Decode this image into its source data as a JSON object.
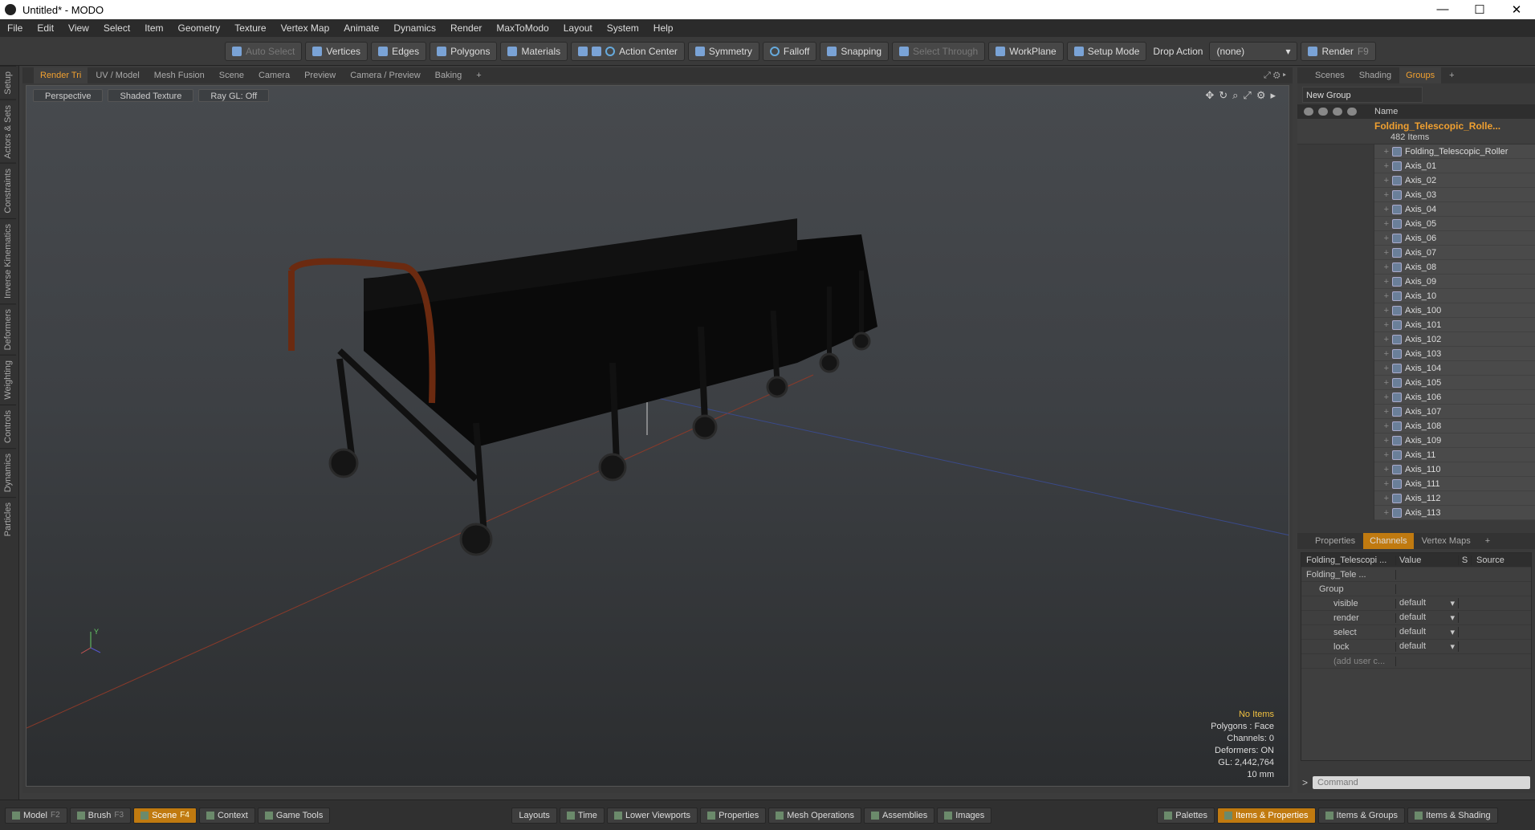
{
  "window": {
    "title": "Untitled* - MODO",
    "controls": [
      "—",
      "☐",
      "✕"
    ]
  },
  "menu": [
    "File",
    "Edit",
    "View",
    "Select",
    "Item",
    "Geometry",
    "Texture",
    "Vertex Map",
    "Animate",
    "Dynamics",
    "Render",
    "MaxToModo",
    "Layout",
    "System",
    "Help"
  ],
  "toolbar": {
    "auto_select": "Auto Select",
    "vertices": "Vertices",
    "edges": "Edges",
    "polygons": "Polygons",
    "materials": "Materials",
    "action_center": "Action Center",
    "symmetry": "Symmetry",
    "falloff": "Falloff",
    "snapping": "Snapping",
    "select_through": "Select Through",
    "workplane": "WorkPlane",
    "setup_mode": "Setup Mode",
    "drop_action_label": "Drop Action",
    "drop_action_value": "(none)",
    "render": "Render",
    "render_key": "F9"
  },
  "left_tabs": [
    "Setup",
    "Actors & Sets",
    "Constraints",
    "Inverse Kinematics",
    "Deformers",
    "Weighting",
    "Controls",
    "Dynamics",
    "Particles"
  ],
  "viewport_tabs": [
    "Render Tri",
    "UV / Model",
    "Mesh Fusion",
    "Scene",
    "Camera",
    "Preview",
    "Camera / Preview",
    "Baking",
    "+"
  ],
  "viewport": {
    "view": "Perspective",
    "shading": "Shaded Texture",
    "raygl": "Ray GL: Off",
    "stats": {
      "items": "No Items",
      "polygons": "Polygons : Face",
      "channels": "Channels: 0",
      "deformers": "Deformers: ON",
      "gl": "GL: 2,442,764",
      "scale": "10 mm"
    },
    "axis_y": "Y"
  },
  "right_tabs": [
    "Scenes",
    "Shading",
    "Groups",
    "+"
  ],
  "groups": {
    "new_group": "New Group",
    "name_header": "Name",
    "group_name": "Folding_Telescopic_Rolle...",
    "group_count": "482 Items",
    "items": [
      "Folding_Telescopic_Roller",
      "Axis_01",
      "Axis_02",
      "Axis_03",
      "Axis_04",
      "Axis_05",
      "Axis_06",
      "Axis_07",
      "Axis_08",
      "Axis_09",
      "Axis_10",
      "Axis_100",
      "Axis_101",
      "Axis_102",
      "Axis_103",
      "Axis_104",
      "Axis_105",
      "Axis_106",
      "Axis_107",
      "Axis_108",
      "Axis_109",
      "Axis_11",
      "Axis_110",
      "Axis_111",
      "Axis_112",
      "Axis_113"
    ]
  },
  "props_tabs": [
    "Properties",
    "Channels",
    "Vertex Maps",
    "+"
  ],
  "channels": {
    "header": [
      "Folding_Telescopi ...",
      "Value",
      "S",
      "Source"
    ],
    "root": "Folding_Tele ...",
    "group": "Group",
    "rows": [
      {
        "name": "visible",
        "value": "default"
      },
      {
        "name": "render",
        "value": "default"
      },
      {
        "name": "select",
        "value": "default"
      },
      {
        "name": "lock",
        "value": "default"
      }
    ],
    "add_user": "(add user c..."
  },
  "command": {
    "prompt": ">",
    "placeholder": "Command"
  },
  "bottom": {
    "model": "Model",
    "model_key": "F2",
    "brush": "Brush",
    "brush_key": "F3",
    "scene": "Scene",
    "scene_key": "F4",
    "context": "Context",
    "game_tools": "Game Tools",
    "layouts": "Layouts",
    "time": "Time",
    "lower_viewports": "Lower Viewports",
    "properties": "Properties",
    "mesh_operations": "Mesh Operations",
    "assemblies": "Assemblies",
    "images": "Images",
    "palettes": "Palettes",
    "items_properties": "Items & Properties",
    "items_groups": "Items & Groups",
    "items_shading": "Items & Shading"
  },
  "colors": {
    "accent": "#f0a030",
    "active_tab": "#c07a10"
  }
}
